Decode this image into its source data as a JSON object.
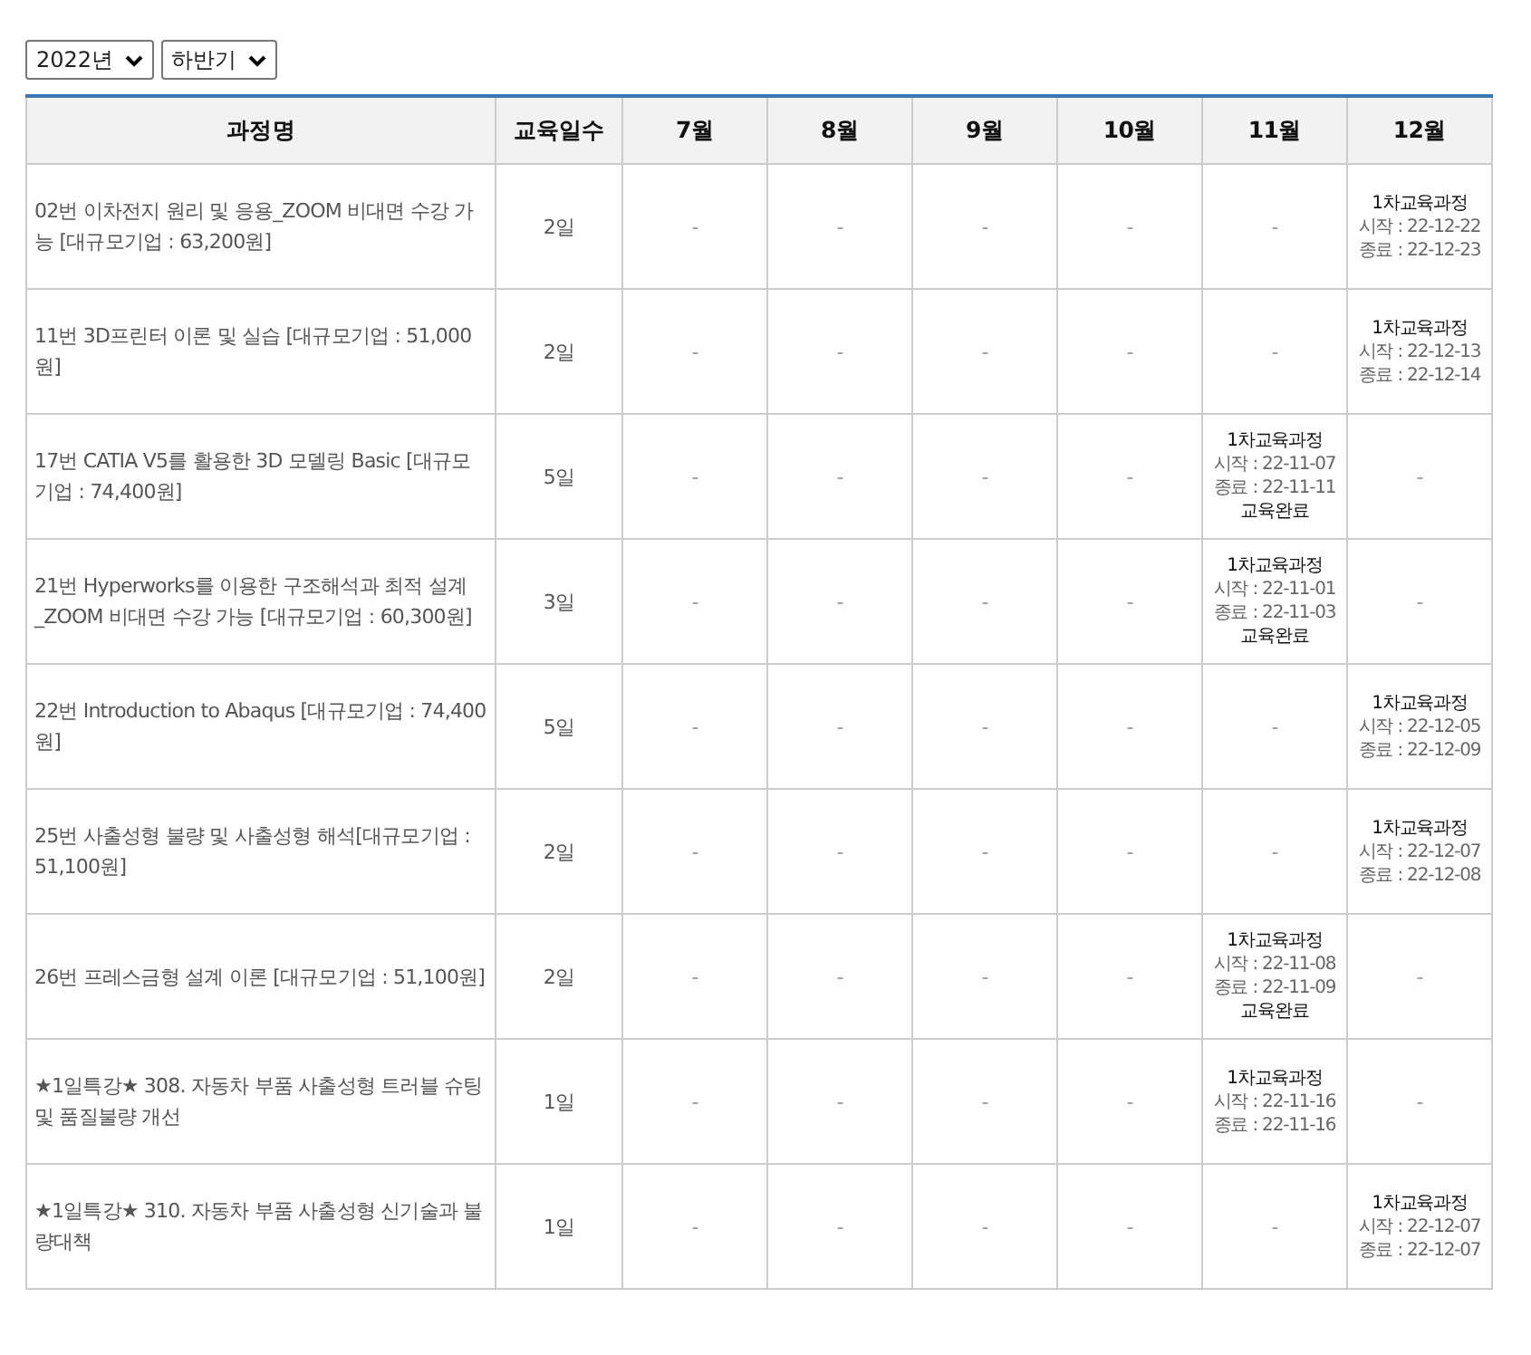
{
  "filters": [
    {
      "value": "2022년"
    },
    {
      "value": "하반기"
    }
  ],
  "table": {
    "columns": [
      "과정명",
      "교육일수",
      "7월",
      "8월",
      "9월",
      "10월",
      "11월",
      "12월"
    ],
    "rows": [
      {
        "name": "02번 이차전지 원리 및 응용_ZOOM 비대면 수강 가능 [대규모기업 : 63,200원]",
        "days": "2일",
        "months": [
          {
            "kind": "empty",
            "text": "-"
          },
          {
            "kind": "empty",
            "text": "-"
          },
          {
            "kind": "empty",
            "text": "-"
          },
          {
            "kind": "empty",
            "text": "-"
          },
          {
            "kind": "empty",
            "text": "-"
          },
          {
            "kind": "session",
            "title": "1차교육과정",
            "start": "시작 : 22-12-22",
            "end": "종료 : 22-12-23"
          }
        ]
      },
      {
        "name": "11번 3D프린터 이론 및 실습 [대규모기업 : 51,000원]",
        "days": "2일",
        "months": [
          {
            "kind": "empty",
            "text": "-"
          },
          {
            "kind": "empty",
            "text": "-"
          },
          {
            "kind": "empty",
            "text": "-"
          },
          {
            "kind": "empty",
            "text": "-"
          },
          {
            "kind": "empty",
            "text": "-"
          },
          {
            "kind": "session",
            "title": "1차교육과정",
            "start": "시작 : 22-12-13",
            "end": "종료 : 22-12-14"
          }
        ]
      },
      {
        "name": "17번 CATIA V5를 활용한 3D 모델링 Basic [대규모기업 : 74,400원]",
        "days": "5일",
        "months": [
          {
            "kind": "empty",
            "text": "-"
          },
          {
            "kind": "empty",
            "text": "-"
          },
          {
            "kind": "empty",
            "text": "-"
          },
          {
            "kind": "empty",
            "text": "-"
          },
          {
            "kind": "session",
            "title": "1차교육과정",
            "start": "시작 : 22-11-07",
            "end": "종료 : 22-11-11",
            "status": "교육완료"
          },
          {
            "kind": "empty",
            "text": "-"
          }
        ]
      },
      {
        "name": "21번 Hyperworks를 이용한 구조해석과 최적 설계_ZOOM 비대면 수강 가능 [대규모기업 : 60,300원]",
        "days": "3일",
        "months": [
          {
            "kind": "empty",
            "text": "-"
          },
          {
            "kind": "empty",
            "text": "-"
          },
          {
            "kind": "empty",
            "text": "-"
          },
          {
            "kind": "empty",
            "text": "-"
          },
          {
            "kind": "session",
            "title": "1차교육과정",
            "start": "시작 : 22-11-01",
            "end": "종료 : 22-11-03",
            "status": "교육완료"
          },
          {
            "kind": "empty",
            "text": "-"
          }
        ]
      },
      {
        "name": "22번 Introduction to Abaqus [대규모기업 : 74,400원]",
        "days": "5일",
        "months": [
          {
            "kind": "empty",
            "text": "-"
          },
          {
            "kind": "empty",
            "text": "-"
          },
          {
            "kind": "empty",
            "text": "-"
          },
          {
            "kind": "empty",
            "text": "-"
          },
          {
            "kind": "empty",
            "text": "-"
          },
          {
            "kind": "session",
            "title": "1차교육과정",
            "start": "시작 : 22-12-05",
            "end": "종료 : 22-12-09"
          }
        ]
      },
      {
        "name": "25번 사출성형 불량 및 사출성형 해석[대규모기업 : 51,100원]",
        "days": "2일",
        "months": [
          {
            "kind": "empty",
            "text": "-"
          },
          {
            "kind": "empty",
            "text": "-"
          },
          {
            "kind": "empty",
            "text": "-"
          },
          {
            "kind": "empty",
            "text": "-"
          },
          {
            "kind": "empty",
            "text": "-"
          },
          {
            "kind": "session",
            "title": "1차교육과정",
            "start": "시작 : 22-12-07",
            "end": "종료 : 22-12-08"
          }
        ]
      },
      {
        "name": "26번 프레스금형 설계 이론 [대규모기업 : 51,100원]",
        "days": "2일",
        "months": [
          {
            "kind": "empty",
            "text": "-"
          },
          {
            "kind": "empty",
            "text": "-"
          },
          {
            "kind": "empty",
            "text": "-"
          },
          {
            "kind": "empty",
            "text": "-"
          },
          {
            "kind": "session",
            "title": "1차교육과정",
            "start": "시작 : 22-11-08",
            "end": "종료 : 22-11-09",
            "status": "교육완료"
          },
          {
            "kind": "empty",
            "text": "-"
          }
        ]
      },
      {
        "name": "★1일특강★ 308. 자동차 부품 사출성형 트러블 슈팅 및 품질불량 개선",
        "days": "1일",
        "months": [
          {
            "kind": "empty",
            "text": "-"
          },
          {
            "kind": "empty",
            "text": "-"
          },
          {
            "kind": "empty",
            "text": "-"
          },
          {
            "kind": "empty",
            "text": "-"
          },
          {
            "kind": "session",
            "title": "1차교육과정",
            "start": "시작 : 22-11-16",
            "end": "종료 : 22-11-16"
          },
          {
            "kind": "empty",
            "text": "-"
          }
        ]
      },
      {
        "name": "★1일특강★ 310. 자동차 부품 사출성형 신기술과 불량대책",
        "days": "1일",
        "months": [
          {
            "kind": "empty",
            "text": "-"
          },
          {
            "kind": "empty",
            "text": "-"
          },
          {
            "kind": "empty",
            "text": "-"
          },
          {
            "kind": "empty",
            "text": "-"
          },
          {
            "kind": "empty",
            "text": "-"
          },
          {
            "kind": "session",
            "title": "1차교육과정",
            "start": "시작 : 22-12-07",
            "end": "종료 : 22-12-07"
          }
        ]
      }
    ]
  }
}
